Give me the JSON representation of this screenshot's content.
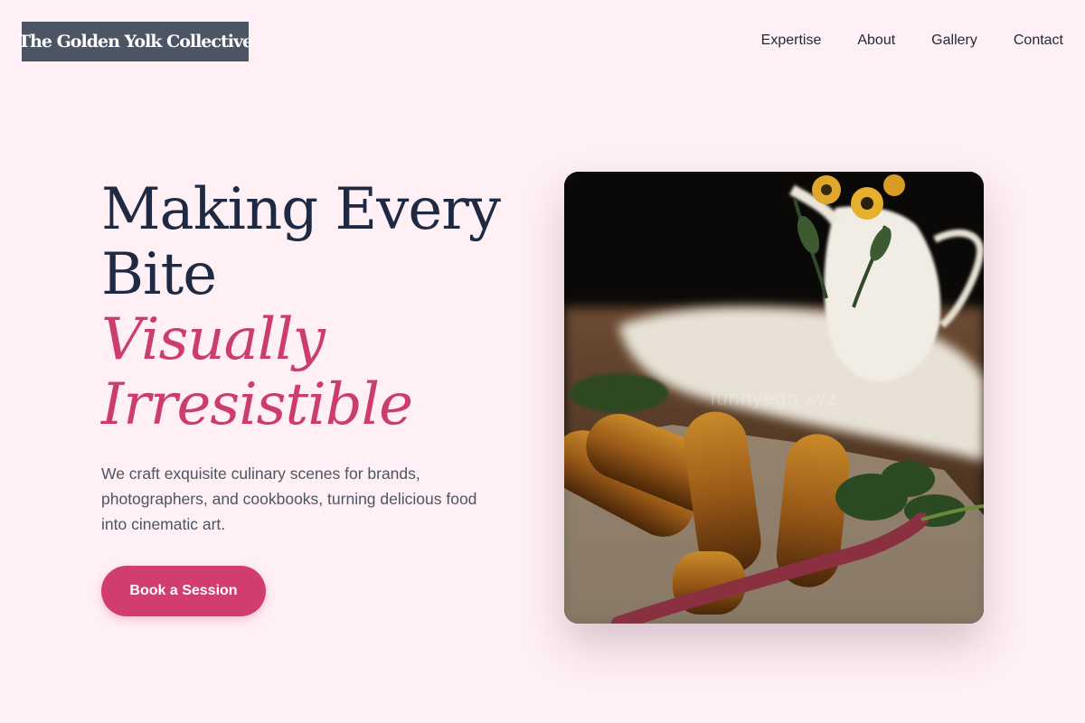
{
  "brand": {
    "logo_text": "The Golden Yolk Collective"
  },
  "nav": {
    "items": [
      {
        "label": "Expertise"
      },
      {
        "label": "About"
      },
      {
        "label": "Gallery"
      },
      {
        "label": "Contact"
      }
    ]
  },
  "hero": {
    "title_line1": "Making Every",
    "title_line2": "Bite",
    "title_accent_line1": "Visually",
    "title_accent_line2": "Irresistible",
    "subtitle": "We craft exquisite culinary scenes for brands, photographers, and cookbooks, turning delicious food into cinematic art.",
    "cta_label": "Book a Session",
    "image_watermark": "funnyegg.xyz"
  },
  "colors": {
    "background": "#fff0f5",
    "heading": "#1e2a44",
    "accent": "#cc3d6e",
    "button": "#d13d6e",
    "logo_bg": "#4b5563"
  }
}
